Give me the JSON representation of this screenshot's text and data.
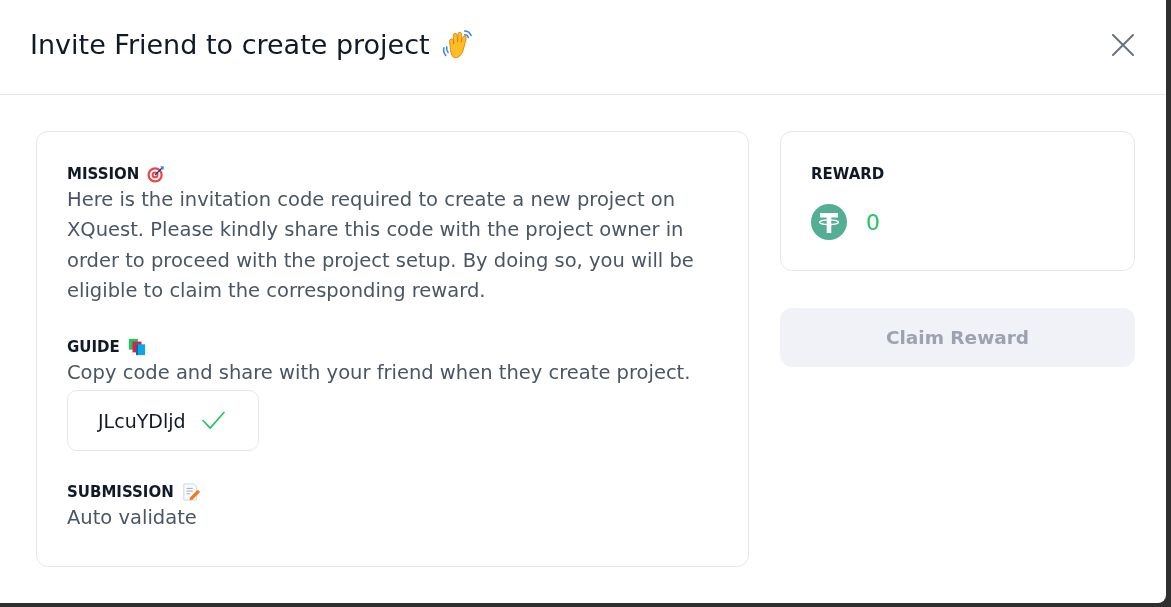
{
  "dialog": {
    "title": "Invite Friend to create project"
  },
  "mission": {
    "heading": "MISSION",
    "text": "Here is the invitation code required to create a new project on XQuest. Please kindly share this code with the project owner in order to proceed with the project setup. By doing so, you will be eligible to claim the corresponding reward."
  },
  "guide": {
    "heading": "GUIDE",
    "text": "Copy code and share with your friend when they create project.",
    "code": "JLcuYDljd",
    "copied": true
  },
  "submission": {
    "heading": "SUBMISSION",
    "text": "Auto validate"
  },
  "reward": {
    "heading": "REWARD",
    "amount": "0"
  },
  "claim_button": {
    "label": "Claim Reward",
    "disabled": true
  }
}
